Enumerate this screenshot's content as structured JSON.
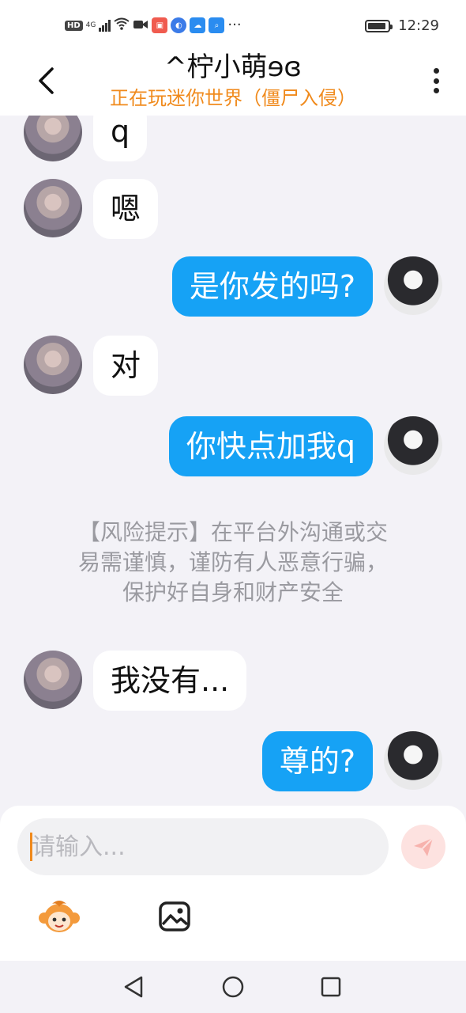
{
  "status_bar": {
    "hd": "HD",
    "signal": "4G",
    "more": "···",
    "battery_level": 0.9,
    "time": "12:29"
  },
  "header": {
    "title": "^柠小萌ɘɞ",
    "subtitle": "正在玩迷你世界（僵尸入侵）",
    "back_icon": "chevron-left-icon",
    "more_icon": "vertical-dots-icon"
  },
  "messages": [
    {
      "side": "in",
      "text": "q"
    },
    {
      "side": "in",
      "text": "嗯"
    },
    {
      "side": "out",
      "text": "是你发的吗?"
    },
    {
      "side": "in",
      "text": "对"
    },
    {
      "side": "out",
      "text": "你快点加我q"
    },
    {
      "side": "in",
      "text": "我没有..."
    },
    {
      "side": "out",
      "text": "尊的?"
    }
  ],
  "notice": {
    "line1": "【风险提示】在平台外沟通或交",
    "line2": "易需谨慎，谨防有人恶意行骗，",
    "line3": "保护好自身和财产安全"
  },
  "input": {
    "placeholder": "请输入...",
    "value": ""
  },
  "toolbar": {
    "emoji_icon": "monkey-emoji-icon",
    "image_icon": "image-icon",
    "send_icon": "paper-plane-icon"
  },
  "nav": {
    "back_icon": "triangle-back-icon",
    "home_icon": "circle-home-icon",
    "recent_icon": "square-recent-icon"
  },
  "colors": {
    "accent_orange": "#f08a1c",
    "bubble_out": "#16a2f5",
    "bubble_in": "#ffffff",
    "background": "#f3f2f7"
  }
}
